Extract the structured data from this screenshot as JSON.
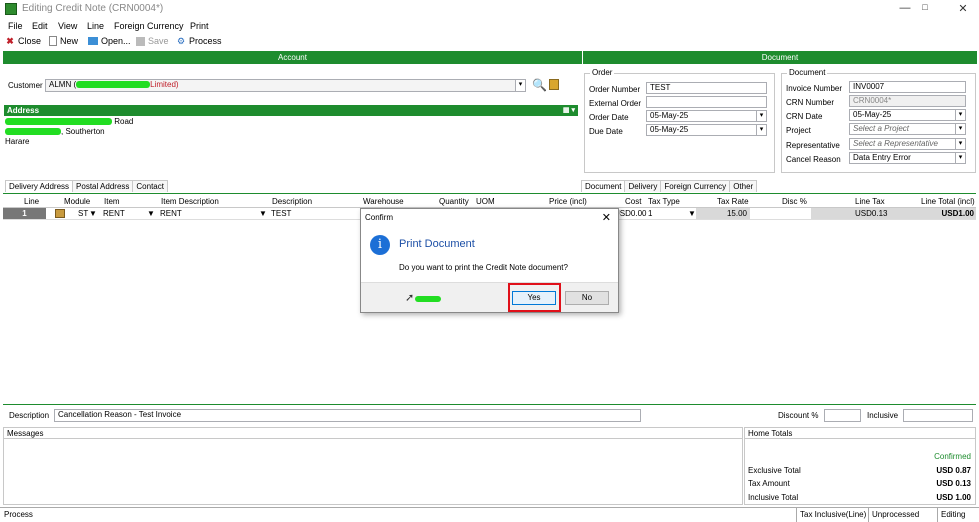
{
  "window": {
    "title": "Editing Credit Note (CRN0004*)",
    "minimize": "—",
    "maximize": "□",
    "close": "✕"
  },
  "menu": [
    "File",
    "Edit",
    "View",
    "Line",
    "Foreign Currency",
    "Print"
  ],
  "toolbar": {
    "close": "Close",
    "new": "New",
    "open": "Open...",
    "save": "Save",
    "process": "Process"
  },
  "sections": {
    "account": "Account",
    "document": "Document"
  },
  "customer": {
    "label": "Customer",
    "code": "ALMN (",
    "name_suffix": "Limited)"
  },
  "address": {
    "title": "Address",
    "line1_suffix": "Road",
    "line2_suffix": ", Southerton",
    "line3": "Harare"
  },
  "order": {
    "title": "Order",
    "order_number_label": "Order Number",
    "order_number": "TEST",
    "external_order_label": "External Order",
    "external_order": "",
    "order_date_label": "Order Date",
    "order_date": "05-May-25",
    "due_date_label": "Due Date",
    "due_date": "05-May-25"
  },
  "document": {
    "title": "Document",
    "invoice_number_label": "Invoice Number",
    "invoice_number": "INV0007",
    "crn_number_label": "CRN Number",
    "crn_number": "CRN0004*",
    "crn_date_label": "CRN Date",
    "crn_date": "05-May-25",
    "project_label": "Project",
    "project_placeholder": "Select a Project",
    "representative_label": "Representative",
    "representative_placeholder": "Select a Representative",
    "cancel_reason_label": "Cancel Reason",
    "cancel_reason": "Data Entry Error"
  },
  "left_tabs": [
    "Delivery Address",
    "Postal Address",
    "Contact"
  ],
  "right_tabs": [
    "Document",
    "Delivery",
    "Foreign Currency",
    "Other"
  ],
  "grid": {
    "headers": [
      "Line",
      "Module",
      "Item",
      "Item Description",
      "Description",
      "Warehouse",
      "Quantity",
      "UOM",
      "Price (incl)",
      "Cost",
      "Tax Type",
      "Tax Rate",
      "Disc %",
      "Line Tax",
      "Line Total (incl)"
    ],
    "row": {
      "line": "1",
      "module": "ST",
      "item": "RENT",
      "item_description": "RENT",
      "description": "TEST",
      "cost": "USD0.00",
      "tax_type": "1",
      "tax_rate": "15.00",
      "line_tax": "USD0.13",
      "line_total": "USD1.00"
    }
  },
  "dialog": {
    "title": "Confirm",
    "heading": "Print Document",
    "message": "Do you want to print the Credit Note document?",
    "yes": "Yes",
    "no": "No"
  },
  "bottom": {
    "description_label": "Description",
    "description": "Cancellation Reason - Test Invoice",
    "discount_label": "Discount %",
    "discount": "",
    "inclusive_label": "Inclusive",
    "inclusive": ""
  },
  "messages": {
    "title": "Messages"
  },
  "totals": {
    "title": "Home Totals",
    "status": "Confirmed",
    "exclusive_label": "Exclusive Total",
    "exclusive": "USD 0.87",
    "tax_label": "Tax Amount",
    "tax": "USD 0.13",
    "inclusive_label": "Inclusive Total",
    "inclusive": "USD 1.00"
  },
  "status": {
    "left": "Process",
    "tax_mode": "Tax Inclusive(Line)",
    "state": "Unprocessed",
    "mode": "Editing"
  },
  "colors": {
    "accent_green": "#1e8c2e",
    "highlight_red": "#e0101a",
    "info_blue": "#1c6fd6"
  }
}
